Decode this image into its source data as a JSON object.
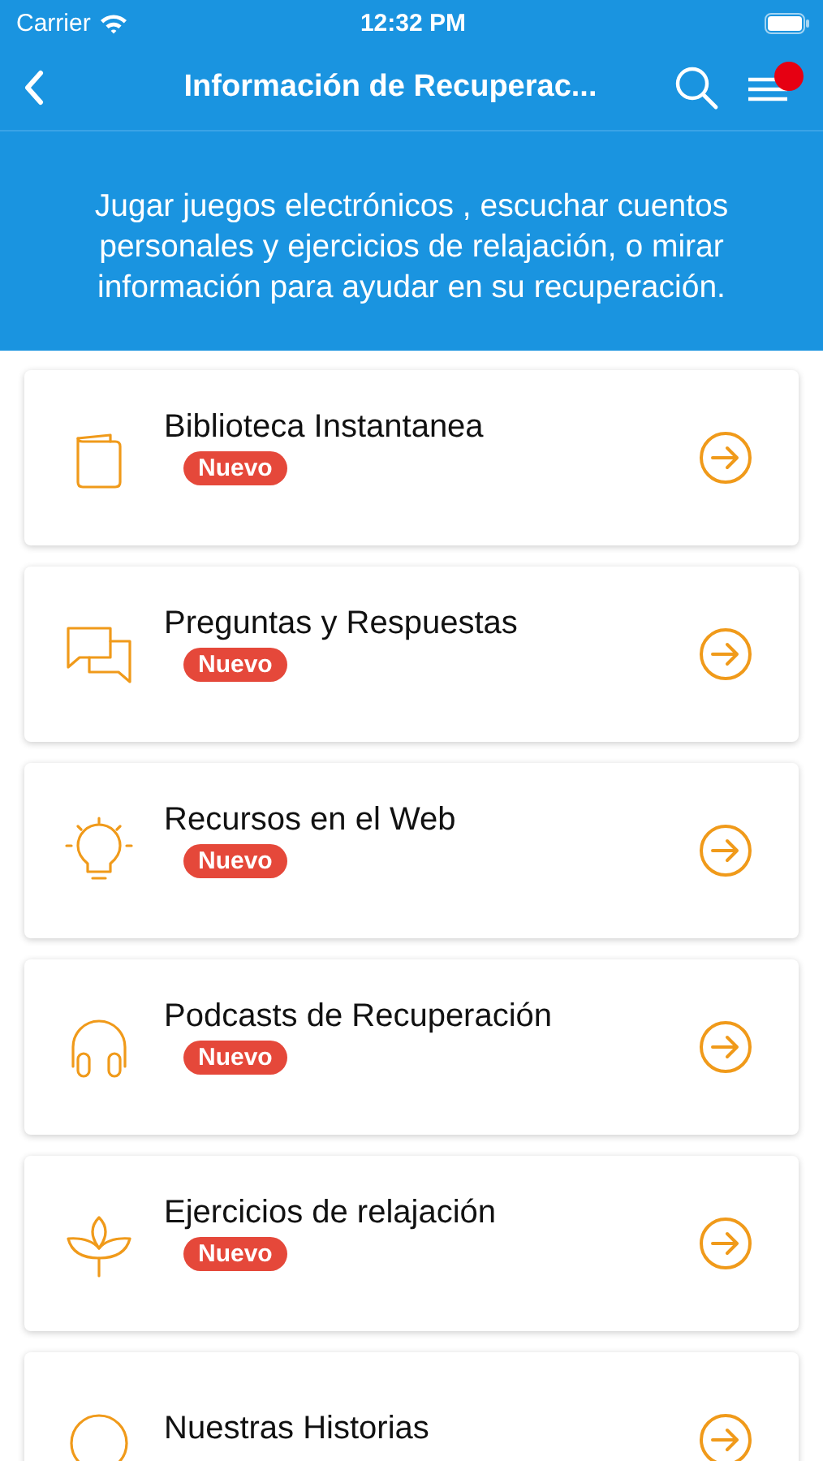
{
  "status_bar": {
    "carrier": "Carrier",
    "time": "12:32 PM"
  },
  "nav": {
    "title": "Información de Recuperac...",
    "menu_notification": true
  },
  "intro": "Jugar juegos electrónicos , escuchar cuentos personales y ejercicios de relajación, o mirar información para ayudar en su recuperación.",
  "items": [
    {
      "kind": "book",
      "title": "Biblioteca Instantanea",
      "badge": "Nuevo"
    },
    {
      "kind": "chat",
      "title": "Preguntas y Respuestas",
      "badge": "Nuevo"
    },
    {
      "kind": "bulb",
      "title": "Recursos en el Web",
      "badge": "Nuevo"
    },
    {
      "kind": "headphones",
      "title": "Podcasts de Recuperación",
      "badge": "Nuevo"
    },
    {
      "kind": "leaf",
      "title": "Ejercicios de relajación",
      "badge": "Nuevo"
    },
    {
      "kind": "circle",
      "title": "Nuestras Historias"
    }
  ]
}
